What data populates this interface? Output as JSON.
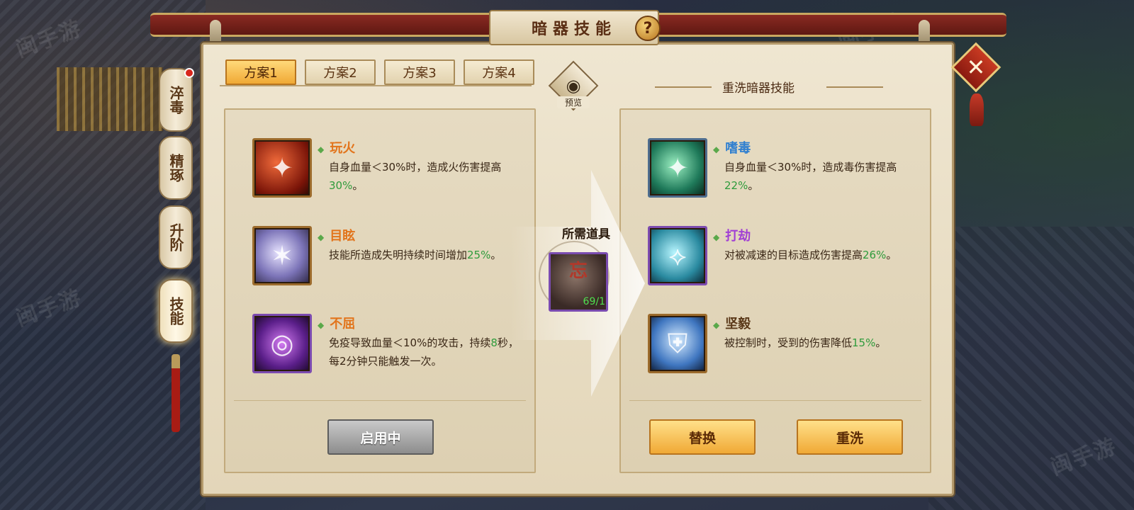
{
  "window": {
    "title": "暗器技能",
    "help_icon": "question-mark-icon",
    "close_icon": "close-x-icon"
  },
  "side_tabs": [
    {
      "label": "淬毒",
      "has_notification": true
    },
    {
      "label": "精琢",
      "has_notification": false
    },
    {
      "label": "升阶",
      "has_notification": false
    },
    {
      "label": "技能",
      "has_notification": false,
      "active": true
    }
  ],
  "plan_tabs": [
    {
      "label": "方案1",
      "active": true
    },
    {
      "label": "方案2",
      "active": false
    },
    {
      "label": "方案3",
      "active": false
    },
    {
      "label": "方案4",
      "active": false
    }
  ],
  "preview": {
    "label": "预览",
    "icon": "eye-icon"
  },
  "reroll_header": "重洗暗器技能",
  "current_skills": [
    {
      "name": "玩火",
      "icon": "fire-dart-icon",
      "desc_pre": "自身血量＜30%时，造成火伤害提高",
      "value": "30%",
      "desc_post": "。"
    },
    {
      "name": "目眩",
      "icon": "dazzle-claw-icon",
      "desc_pre": "技能所造成失明持续时间增加",
      "value": "25%",
      "desc_post": "。"
    },
    {
      "name": "不屈",
      "icon": "purple-ring-icon",
      "desc_pre": "免疫导致血量＜10%的攻击，持续",
      "value": "8",
      "desc_post": "秒，每2分钟只能触发一次。"
    }
  ],
  "new_skills": [
    {
      "name": "嗜毒",
      "icon": "poison-dart-icon",
      "desc_pre": "自身血量＜30%时，造成毒伤害提高",
      "value": "22%",
      "desc_post": "。"
    },
    {
      "name": "打劫",
      "icon": "ice-blade-icon",
      "desc_pre": "对被减速的目标造成伤害提高",
      "value": "26%",
      "desc_post": "。"
    },
    {
      "name": "坚毅",
      "icon": "shield-icon",
      "desc_pre": "被控制时，受到的伤害降低",
      "value": "15%",
      "desc_post": "。"
    }
  ],
  "required_item": {
    "label": "所需道具",
    "glyph": "忘",
    "count": "69/1",
    "icon": "forget-stone-icon"
  },
  "buttons": {
    "active_label": "启用中",
    "replace_label": "替换",
    "reroll_label": "重洗"
  },
  "watermark": "闽手游",
  "colors": {
    "accent_gold": "#f0a935",
    "value_green": "#2f9b3c",
    "name_orange": "#e2741b",
    "name_blue": "#2f7fd0",
    "name_purple": "#a13fd4",
    "name_brown": "#5a3818"
  }
}
